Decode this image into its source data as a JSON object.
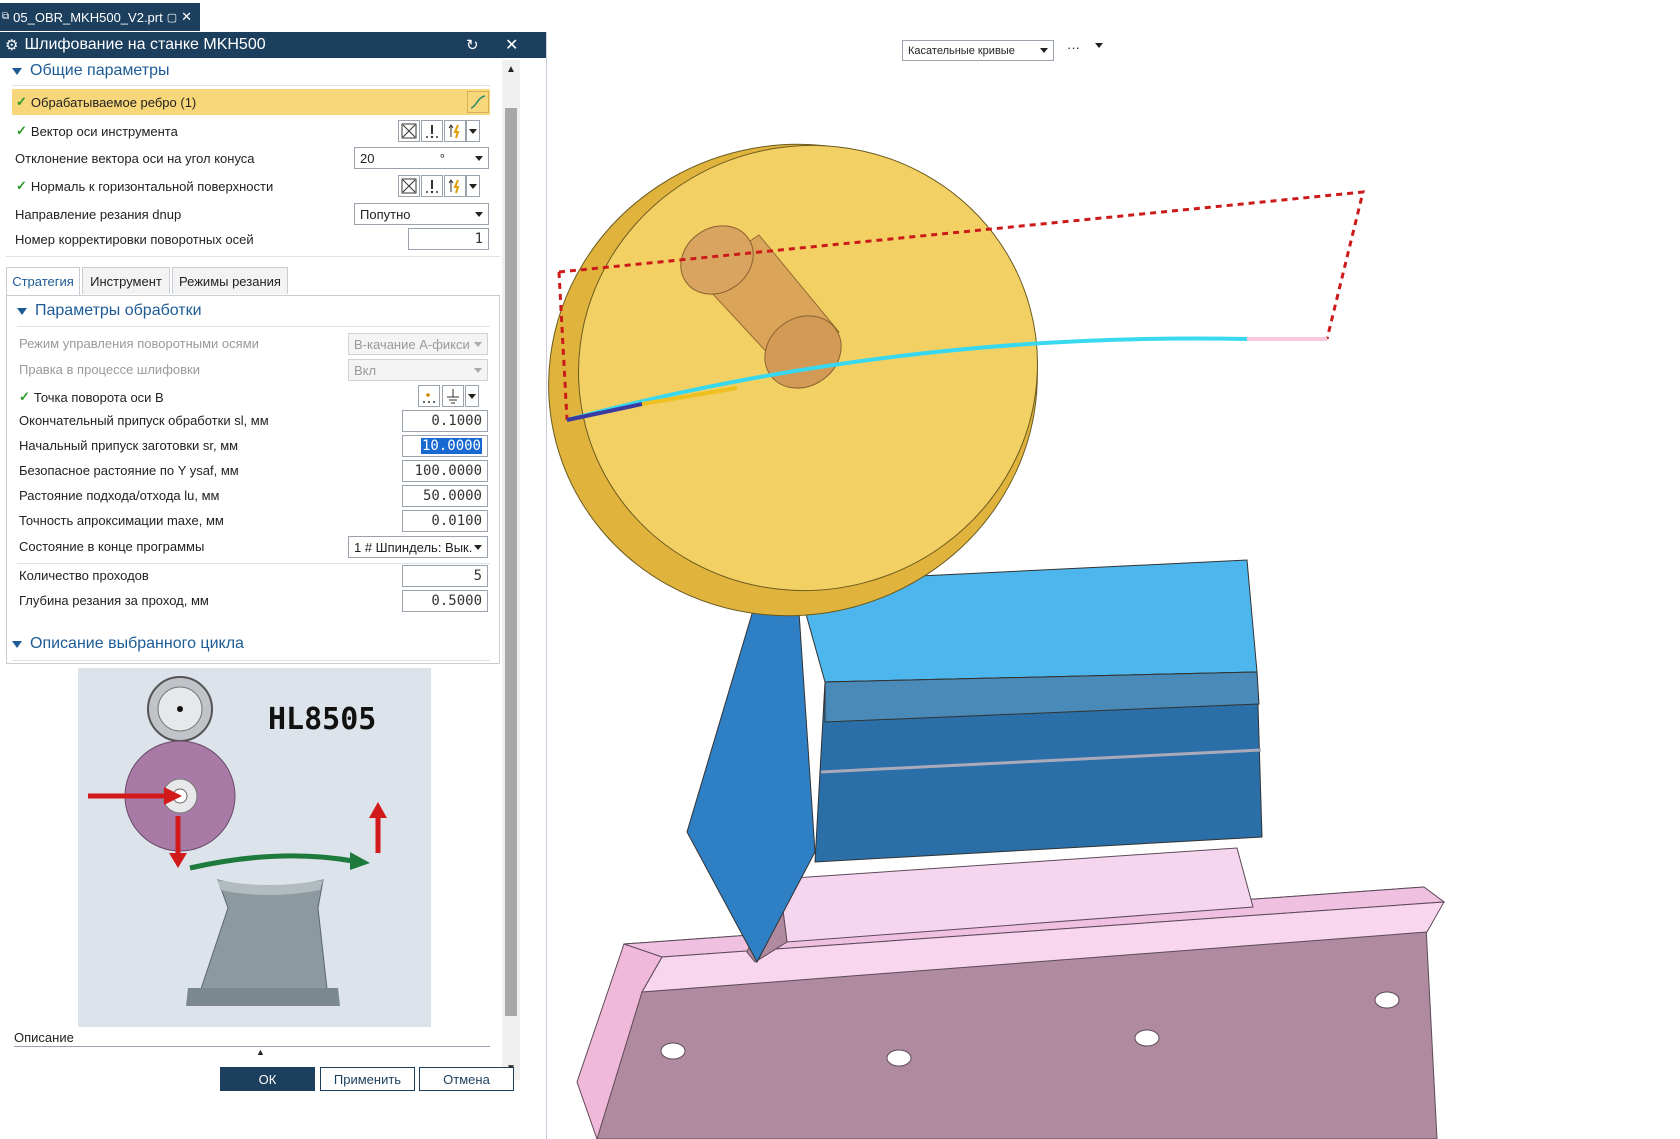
{
  "file_tab": {
    "title": "05_OBR_MKH500_V2.prt"
  },
  "dialog": {
    "title": "Шлифование на станке MKH500",
    "general": {
      "header": "Общие параметры",
      "rows": [
        {
          "label": "Обрабатываемое ребро (1)"
        },
        {
          "label": "Вектор оси инструмента"
        },
        {
          "label": "Отклонение вектора оси на угол конуса",
          "value": "20",
          "unit": "°"
        },
        {
          "label": "Нормаль к горизонтальной поверхности"
        },
        {
          "label": "Направление резания  dnup",
          "value": "Попутно"
        },
        {
          "label": "Номер корректировки поворотных осей",
          "value": "1"
        }
      ]
    },
    "tabs": [
      "Стратегия",
      "Инструмент",
      "Режимы резания"
    ],
    "processing": {
      "header": "Параметры обработки",
      "rows": [
        {
          "label": "Режим управления поворотными осями",
          "value": "B-качание A-фикси"
        },
        {
          "label": "Правка в процессе шлифовки",
          "value": "Вкл"
        },
        {
          "label": "Точка поворота оси B"
        },
        {
          "label": "Окончательный припуск обработки sl, мм",
          "value": "0.1000"
        },
        {
          "label": "Начальный припуск заготовки sr, мм",
          "value": "10.0000"
        },
        {
          "label": "Безопасное растояние по Y ysaf, мм",
          "value": "100.0000"
        },
        {
          "label": "Растояние подхода/отхода lu, мм",
          "value": "50.0000"
        },
        {
          "label": "Точность апроксимации maxe, мм",
          "value": "0.0100"
        },
        {
          "label": "Состояние в конце программы",
          "value": "1 # Шпиндель: Вык."
        },
        {
          "label": "Количество проходов",
          "value": "5"
        },
        {
          "label": "Глубина резания за проход, мм",
          "value": "0.5000"
        }
      ]
    },
    "cycle": {
      "header": "Описание выбранного цикла",
      "image_label": "HL8505"
    },
    "description_label": "Описание",
    "buttons": {
      "ok": "ОК",
      "apply": "Применить",
      "cancel": "Отмена"
    }
  },
  "viewport_toolbar": {
    "filter_value": "Касательные кривые",
    "more": "···"
  },
  "colors": {
    "title_bar": "#1c3f5e",
    "accent": "#1d5b96",
    "highlight_row": "#f8d77a",
    "selection": "#1769d1"
  }
}
